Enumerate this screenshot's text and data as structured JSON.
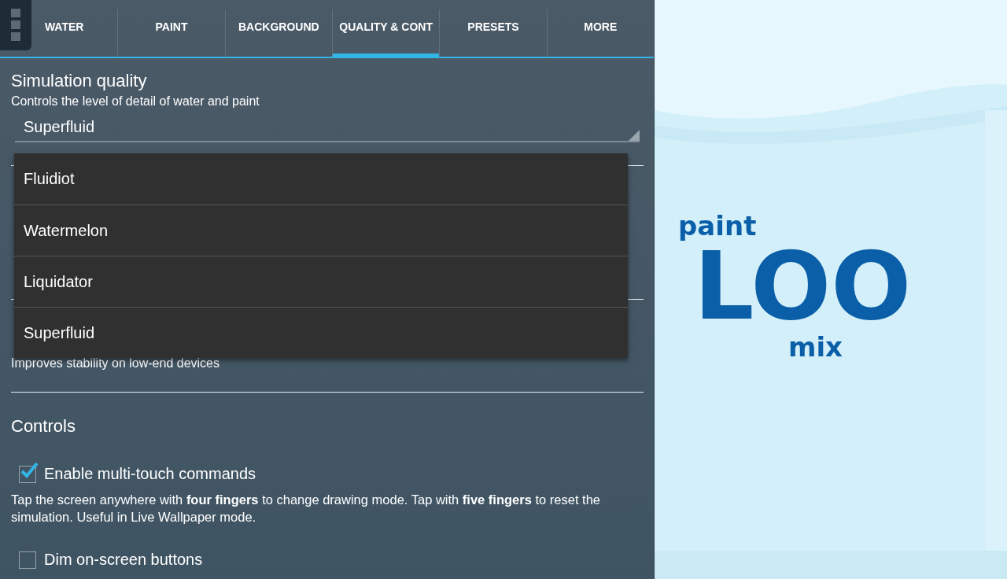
{
  "tabs": [
    {
      "label": "WATER",
      "selected": false
    },
    {
      "label": "PAINT",
      "selected": false
    },
    {
      "label": "BACKGROUND",
      "selected": false
    },
    {
      "label": "QUALITY & CONT",
      "selected": true
    },
    {
      "label": "PRESETS",
      "selected": false
    },
    {
      "label": "MORE",
      "selected": false
    }
  ],
  "quality": {
    "title": "Simulation quality",
    "subtitle": "Controls the level of detail of water and paint",
    "value": "Superfluid",
    "options": [
      {
        "label": "Fluidiot"
      },
      {
        "label": "Watermelon"
      },
      {
        "label": "Liquidator"
      },
      {
        "label": "Superfluid"
      }
    ]
  },
  "stability_note": "Improves stability on low-end devices",
  "controls": {
    "title": "Controls",
    "options": [
      {
        "label": "Enable multi-touch commands",
        "checked": true,
        "description": "Tap the screen anywhere with **four fingers** to change drawing mode. Tap with **five fingers** to reset the simulation. Useful in Live Wallpaper mode."
      },
      {
        "label": "Dim on-screen buttons",
        "checked": false
      }
    ]
  },
  "logo": {
    "words": [
      "paint",
      "LOO",
      "mix"
    ]
  }
}
